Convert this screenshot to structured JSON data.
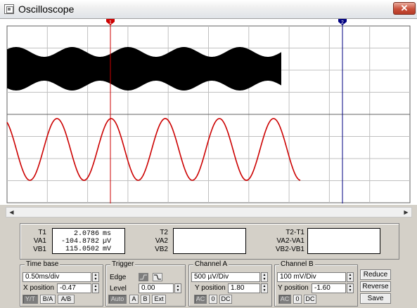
{
  "window": {
    "title": "Oscilloscope",
    "close_glyph": "✕"
  },
  "markers": {
    "t1_label": "1",
    "t2_label": "2"
  },
  "scrollbar": {
    "left_arrow": "◀",
    "right_arrow": "▶"
  },
  "readout": {
    "t1": {
      "labels": [
        "T1",
        "VA1",
        "VB1"
      ],
      "values": [
        "2.0786",
        "-104.8782",
        "115.0502"
      ],
      "units": [
        "ms",
        "µV",
        "mV"
      ]
    },
    "t2": {
      "labels": [
        "T2",
        "VA2",
        "VB2"
      ]
    },
    "diff": {
      "labels": [
        "T2-T1",
        "VA2-VA1",
        "VB2-VB1"
      ]
    }
  },
  "timebase": {
    "label": "Time base",
    "scale": "0.50ms/div",
    "xpos_label": "X position",
    "xpos": "-0.47",
    "modes": [
      "Y/T",
      "B/A",
      "A/B"
    ]
  },
  "trigger": {
    "label": "Trigger",
    "edge_label": "Edge",
    "level_label": "Level",
    "level": "0.00",
    "sources": [
      "Auto",
      "A",
      "B",
      "Ext"
    ]
  },
  "channel_a": {
    "label": "Channel A",
    "scale": "500 µV/Div",
    "ypos_label": "Y position",
    "ypos": "1.80",
    "coupling": [
      "AC",
      "0",
      "DC"
    ]
  },
  "channel_b": {
    "label": "Channel B",
    "scale": "100 mV/Div",
    "ypos_label": "Y position",
    "ypos": "-1.60",
    "coupling": [
      "AC",
      "0",
      "DC"
    ]
  },
  "actions": {
    "reduce": "Reduce",
    "reverse": "Reverse",
    "save": "Save"
  },
  "colors": {
    "channel_a": "#000000",
    "channel_b": "#cc0000",
    "cursor1": "#cc0000",
    "cursor2": "#000080",
    "grid": "#c0c0c0"
  }
}
